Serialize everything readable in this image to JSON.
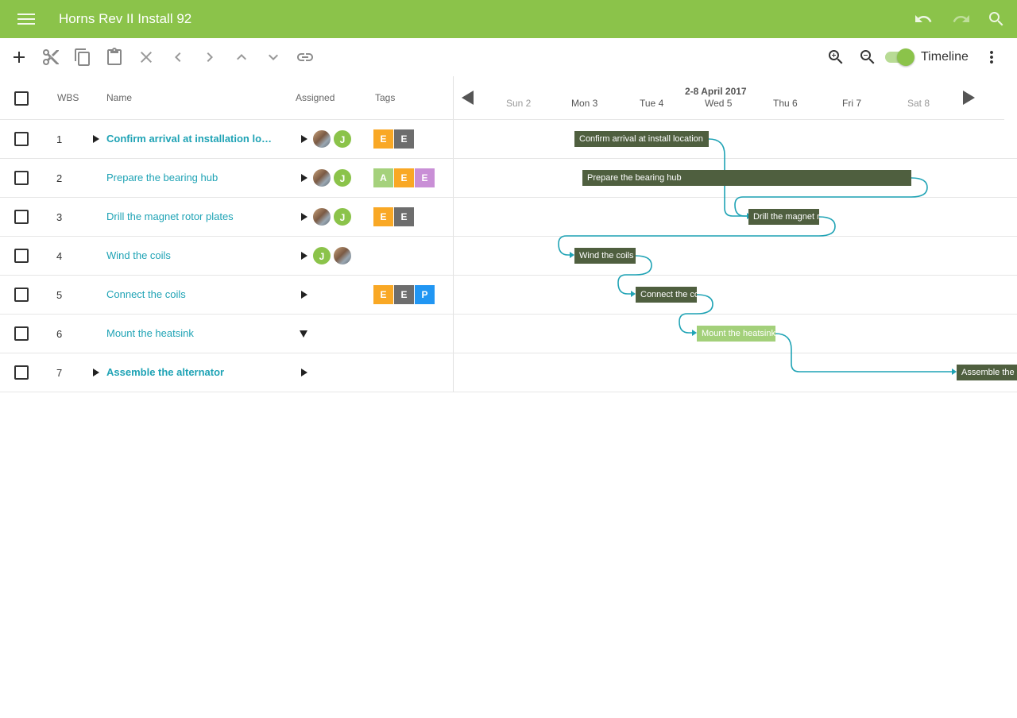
{
  "app": {
    "title": "Horns Rev II Install 92"
  },
  "toolbar": {
    "timeline_label": "Timeline",
    "timeline_on": true
  },
  "grid": {
    "headers": {
      "wbs": "WBS",
      "name": "Name",
      "assigned": "Assigned",
      "tags": "Tags"
    },
    "rows": [
      {
        "wbs": "1",
        "name": "Confirm arrival at installation locati…",
        "bold": true,
        "expander": "right",
        "avatars": [
          "photo",
          "J"
        ],
        "tags": [
          {
            "label": "E",
            "color": "#f9a825"
          },
          {
            "label": "E",
            "color": "#6d6d6d"
          }
        ]
      },
      {
        "wbs": "2",
        "name": "Prepare the bearing hub",
        "bold": false,
        "expander": "none",
        "avatars": [
          "photo",
          "J"
        ],
        "tags": [
          {
            "label": "A",
            "color": "#a5d17c"
          },
          {
            "label": "E",
            "color": "#f9a825"
          },
          {
            "label": "E",
            "color": "#c98fd6"
          }
        ]
      },
      {
        "wbs": "3",
        "name": "Drill the magnet rotor plates",
        "bold": false,
        "expander": "none",
        "avatars": [
          "photo",
          "J"
        ],
        "tags": [
          {
            "label": "E",
            "color": "#f9a825"
          },
          {
            "label": "E",
            "color": "#6d6d6d"
          }
        ]
      },
      {
        "wbs": "4",
        "name": "Wind the coils",
        "bold": false,
        "expander": "none",
        "avatars": [
          "J",
          "photo"
        ],
        "tags": []
      },
      {
        "wbs": "5",
        "name": "Connect the coils",
        "bold": false,
        "expander": "none",
        "avatars": [],
        "tags": [
          {
            "label": "E",
            "color": "#f9a825"
          },
          {
            "label": "E",
            "color": "#6d6d6d"
          },
          {
            "label": "P",
            "color": "#2196f3"
          }
        ]
      },
      {
        "wbs": "6",
        "name": "Mount the heatsink",
        "bold": false,
        "expander": "none",
        "avatars": [],
        "assigned_caret": "down",
        "tags": []
      },
      {
        "wbs": "7",
        "name": "Assemble the alternator",
        "bold": true,
        "expander": "right",
        "avatars": [],
        "tags": []
      }
    ]
  },
  "timeline": {
    "range_label": "2-8 April 2017",
    "days": [
      {
        "label": "Sun 2",
        "weekend": true
      },
      {
        "label": "Mon 3",
        "weekend": false
      },
      {
        "label": "Tue 4",
        "weekend": false
      },
      {
        "label": "Wed 5",
        "weekend": false
      },
      {
        "label": "Thu 6",
        "weekend": false
      },
      {
        "label": "Fri 7",
        "weekend": false
      },
      {
        "label": "Sat 8",
        "weekend": true
      }
    ],
    "bars": [
      {
        "label": "Confirm arrival at install location",
        "light": false
      },
      {
        "label": "Prepare the bearing hub",
        "light": false
      },
      {
        "label": "Drill the magnet rotor plates",
        "light": false
      },
      {
        "label": "Wind the coils",
        "light": false
      },
      {
        "label": "Connect the coils",
        "light": false
      },
      {
        "label": "Mount the heatsink",
        "light": true
      },
      {
        "label": "Assemble the alternator",
        "light": false
      }
    ]
  },
  "colors": {
    "accent": "#8bc34a",
    "link": "#1fa3b5",
    "bar": "#4f5f3f",
    "dependency": "#1fa3b5"
  }
}
